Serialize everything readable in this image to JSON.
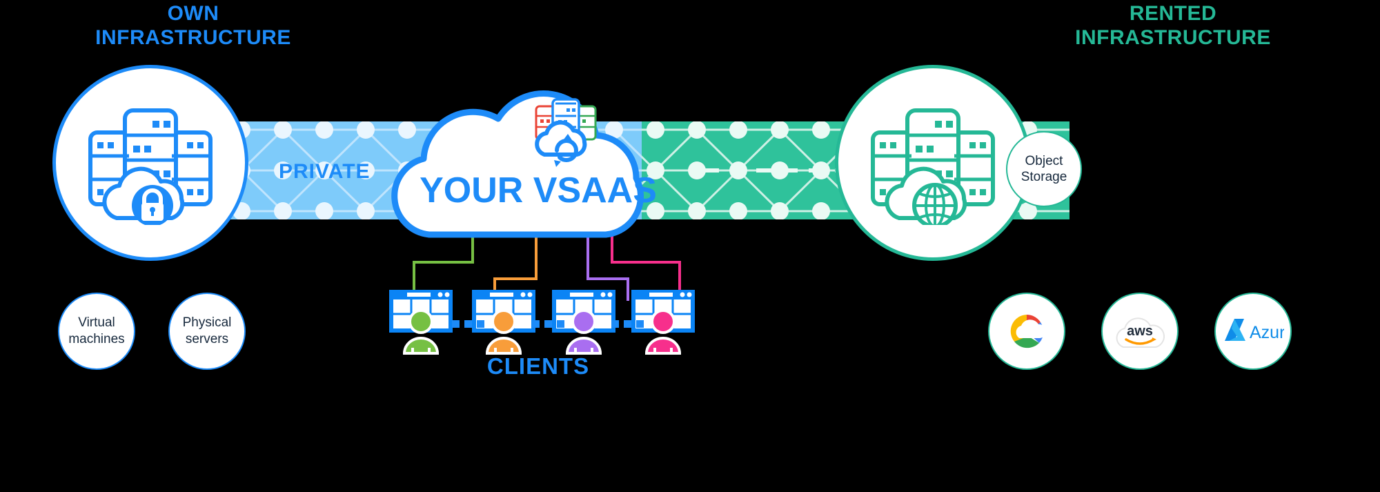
{
  "headings": {
    "own": "OWN\nINFRASTRUCTURE",
    "rented": "RENTED\nINFRASTRUCTURE"
  },
  "bands": {
    "private_label": "PRIVATE"
  },
  "center": {
    "cloud_label": "YOUR VSAAS",
    "icon_name": "cloud-sync-servers-icon"
  },
  "own_side": {
    "circle_icon": "servers-with-locked-cloud-icon",
    "options": [
      {
        "label": "Virtual\nmachines",
        "name": "virtual-machines"
      },
      {
        "label": "Physical\nservers",
        "name": "physical-servers"
      }
    ]
  },
  "rented_side": {
    "circle_icon": "servers-with-globe-cloud-icon",
    "object_storage_label": "Object\nStorage",
    "providers": [
      {
        "label": "Google Cloud",
        "name": "google-cloud-logo"
      },
      {
        "label": "aws",
        "name": "aws-logo"
      },
      {
        "label": "Azure",
        "name": "azure-logo"
      }
    ]
  },
  "clients": {
    "title": "CLIENTS",
    "items": [
      {
        "name": "client-green",
        "color": "#76c043"
      },
      {
        "name": "client-orange",
        "color": "#f89d3a"
      },
      {
        "name": "client-purple",
        "color": "#a96ef0"
      },
      {
        "name": "client-pink",
        "color": "#f72f8c"
      }
    ],
    "separator": "···"
  },
  "colors": {
    "blue": "#1d8bf8",
    "light_blue_band": "#7ecbfa",
    "green": "#25b896",
    "green_band": "#2fc29b",
    "text_dark": "#16283c",
    "background": "#000000"
  }
}
